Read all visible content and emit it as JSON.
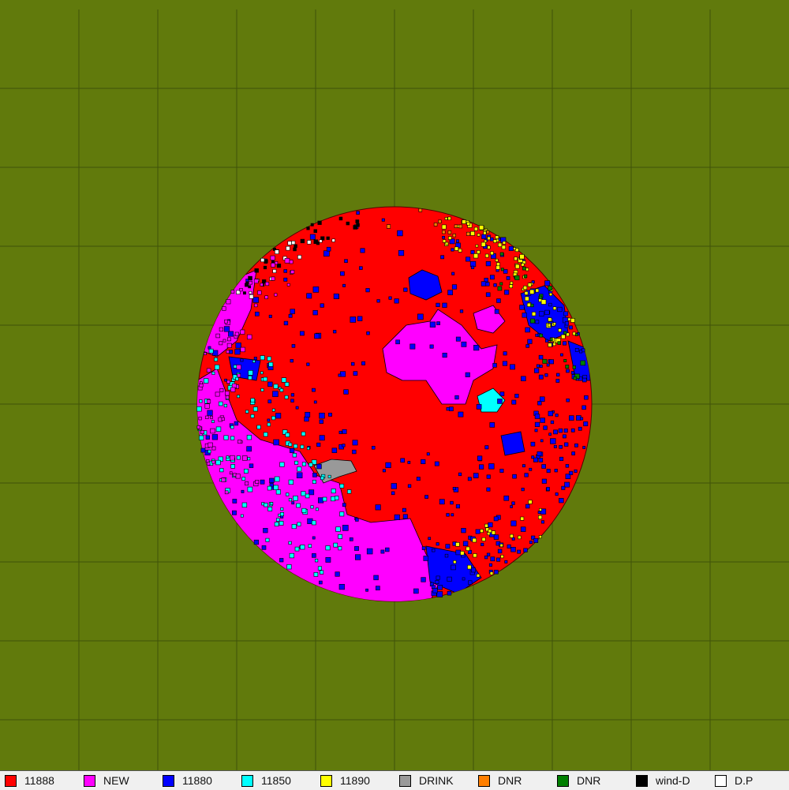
{
  "map": {
    "background_color": "#617a0c",
    "grid_color": "#3f520a",
    "base_color": "#ff0000"
  },
  "legend": [
    {
      "label": "11888",
      "color": "#ff0000"
    },
    {
      "label": "NEW",
      "color": "#ff00ff"
    },
    {
      "label": "11880",
      "color": "#0000ff"
    },
    {
      "label": "11850",
      "color": "#00ffff"
    },
    {
      "label": "11890",
      "color": "#ffff00"
    },
    {
      "label": "DRINK",
      "color": "#999999"
    },
    {
      "label": "DNR",
      "color": "#ff7f00"
    },
    {
      "label": "DNR",
      "color": "#007f00"
    },
    {
      "label": "wind-D",
      "color": "#000000"
    },
    {
      "label": "D.P",
      "color": "#ffffff"
    }
  ]
}
